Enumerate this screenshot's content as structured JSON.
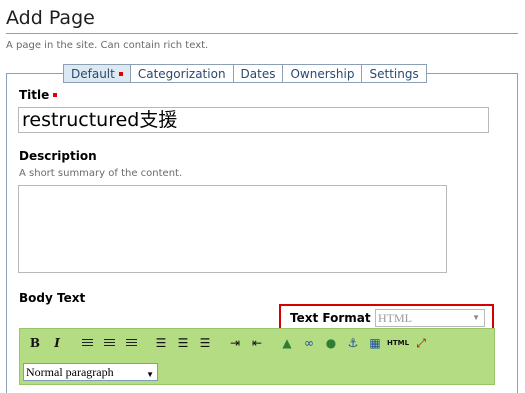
{
  "header": {
    "title": "Add Page",
    "description": "A page in the site. Can contain rich text."
  },
  "tabs": [
    {
      "label": "Default",
      "active": true,
      "required": true
    },
    {
      "label": "Categorization"
    },
    {
      "label": "Dates"
    },
    {
      "label": "Ownership"
    },
    {
      "label": "Settings"
    }
  ],
  "fields": {
    "title": {
      "label": "Title",
      "value": "restructured支援",
      "required": true
    },
    "description": {
      "label": "Description",
      "help": "A short summary of the content.",
      "value": ""
    },
    "body": {
      "label": "Body Text"
    }
  },
  "text_format": {
    "label": "Text Format",
    "value": "HTML"
  },
  "editor": {
    "toolbar_icons": [
      "bold-icon",
      "italic-icon",
      "align-left-icon",
      "align-center-icon",
      "align-right-icon",
      "numbered-list-icon",
      "bullet-list-icon",
      "definition-list-icon",
      "indent-icon",
      "outdent-icon",
      "image-icon",
      "link-icon",
      "anchor-link-icon",
      "anchor-icon",
      "table-icon",
      "html-source-icon",
      "fullscreen-icon"
    ],
    "bold_glyph": "B",
    "italic_glyph": "I",
    "html_glyph": "HTML",
    "paragraph_style": "Normal paragraph"
  },
  "colors": {
    "accent": "#2a4a6f",
    "required": "#e00000",
    "highlight_box": "#d50000",
    "editor_toolbar": "#b4dc82"
  }
}
